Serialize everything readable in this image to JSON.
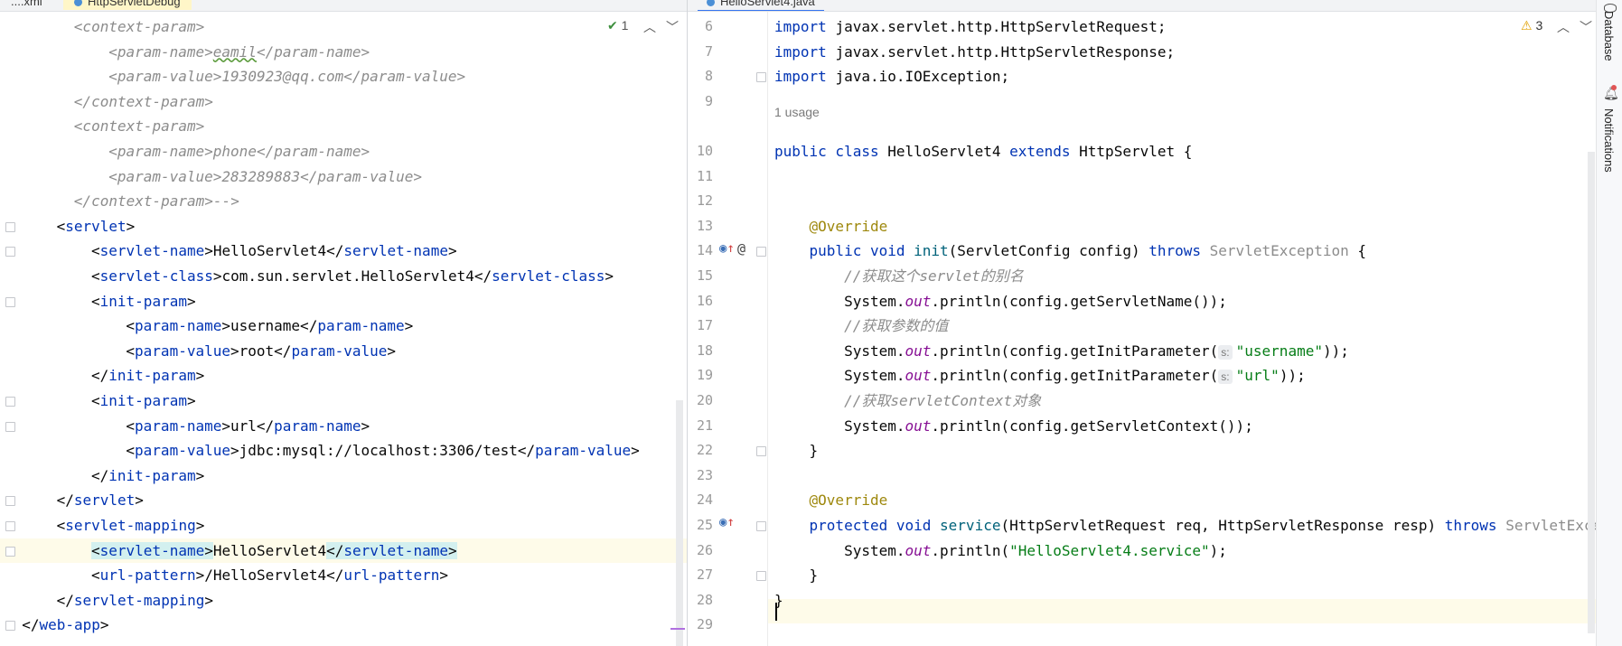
{
  "tabs": [
    {
      "label": "....xml",
      "active": false
    },
    {
      "label": "HttpServletDebug",
      "active": false
    },
    {
      "label": "HelloServlet4.java",
      "active": true
    }
  ],
  "right_tool_window": {
    "database_label": "Database",
    "notifications_label": "Notifications"
  },
  "left_editor": {
    "check_count": "1",
    "lines": [
      {
        "id": "l1",
        "indent": 4,
        "tokens": [
          {
            "t": "<context-param>",
            "c": "com"
          }
        ]
      },
      {
        "id": "l2",
        "indent": 6,
        "tokens": [
          {
            "t": "<param-name>",
            "c": "com"
          },
          {
            "t": "eamil",
            "c": "com under"
          },
          {
            "t": "</param-name>",
            "c": "com"
          }
        ]
      },
      {
        "id": "l3",
        "indent": 6,
        "tokens": [
          {
            "t": "<param-value>1930923@qq.com</param-value>",
            "c": "com"
          }
        ]
      },
      {
        "id": "l4",
        "indent": 4,
        "tokens": [
          {
            "t": "</context-param>",
            "c": "com"
          }
        ]
      },
      {
        "id": "l5",
        "indent": 4,
        "tokens": [
          {
            "t": "<context-param>",
            "c": "com"
          }
        ]
      },
      {
        "id": "l6",
        "indent": 6,
        "tokens": [
          {
            "t": "<param-name>phone</param-name>",
            "c": "com"
          }
        ]
      },
      {
        "id": "l7",
        "indent": 6,
        "tokens": [
          {
            "t": "<param-value>283289883</param-value>",
            "c": "com"
          }
        ]
      },
      {
        "id": "l8",
        "indent": 4,
        "tokens": [
          {
            "t": "</context-param>-->",
            "c": "com"
          }
        ]
      },
      {
        "id": "l9",
        "indent": 3,
        "tokens": [
          {
            "t": "<",
            "c": "txt"
          },
          {
            "t": "servlet",
            "c": "tag"
          },
          {
            "t": ">",
            "c": "txt"
          }
        ]
      },
      {
        "id": "l10",
        "indent": 5,
        "tokens": [
          {
            "t": "<",
            "c": "txt"
          },
          {
            "t": "servlet-name",
            "c": "tag"
          },
          {
            "t": ">HelloServlet4</",
            "c": "txt"
          },
          {
            "t": "servlet-name",
            "c": "tag"
          },
          {
            "t": ">",
            "c": "txt"
          }
        ]
      },
      {
        "id": "l11",
        "indent": 5,
        "tokens": [
          {
            "t": "<",
            "c": "txt"
          },
          {
            "t": "servlet-class",
            "c": "tag"
          },
          {
            "t": ">com.sun.servlet.HelloServlet4</",
            "c": "txt"
          },
          {
            "t": "servlet-class",
            "c": "tag"
          },
          {
            "t": ">",
            "c": "txt"
          }
        ]
      },
      {
        "id": "l12",
        "indent": 5,
        "tokens": [
          {
            "t": "<",
            "c": "txt"
          },
          {
            "t": "init-param",
            "c": "tag"
          },
          {
            "t": ">",
            "c": "txt"
          }
        ]
      },
      {
        "id": "l13",
        "indent": 7,
        "tokens": [
          {
            "t": "<",
            "c": "txt"
          },
          {
            "t": "param-name",
            "c": "tag"
          },
          {
            "t": ">username</",
            "c": "txt"
          },
          {
            "t": "param-name",
            "c": "tag"
          },
          {
            "t": ">",
            "c": "txt"
          }
        ]
      },
      {
        "id": "l14",
        "indent": 7,
        "tokens": [
          {
            "t": "<",
            "c": "txt"
          },
          {
            "t": "param-value",
            "c": "tag"
          },
          {
            "t": ">root</",
            "c": "txt"
          },
          {
            "t": "param-value",
            "c": "tag"
          },
          {
            "t": ">",
            "c": "txt"
          }
        ]
      },
      {
        "id": "l15",
        "indent": 5,
        "tokens": [
          {
            "t": "</",
            "c": "txt"
          },
          {
            "t": "init-param",
            "c": "tag"
          },
          {
            "t": ">",
            "c": "txt"
          }
        ]
      },
      {
        "id": "l16",
        "indent": 5,
        "tokens": [
          {
            "t": "<",
            "c": "txt"
          },
          {
            "t": "init-param",
            "c": "tag"
          },
          {
            "t": ">",
            "c": "txt"
          }
        ]
      },
      {
        "id": "l17",
        "indent": 7,
        "tokens": [
          {
            "t": "<",
            "c": "txt"
          },
          {
            "t": "param-name",
            "c": "tag"
          },
          {
            "t": ">url</",
            "c": "txt"
          },
          {
            "t": "param-name",
            "c": "tag"
          },
          {
            "t": ">",
            "c": "txt"
          }
        ]
      },
      {
        "id": "l18",
        "indent": 7,
        "tokens": [
          {
            "t": "<",
            "c": "txt"
          },
          {
            "t": "param-value",
            "c": "tag"
          },
          {
            "t": ">jdbc:mysql://localhost:3306/test</",
            "c": "txt"
          },
          {
            "t": "param-value",
            "c": "tag"
          },
          {
            "t": ">",
            "c": "txt"
          }
        ]
      },
      {
        "id": "l19",
        "indent": 5,
        "tokens": [
          {
            "t": "</",
            "c": "txt"
          },
          {
            "t": "init-param",
            "c": "tag"
          },
          {
            "t": ">",
            "c": "txt"
          }
        ]
      },
      {
        "id": "l20",
        "indent": 3,
        "tokens": [
          {
            "t": "</",
            "c": "txt"
          },
          {
            "t": "servlet",
            "c": "tag"
          },
          {
            "t": ">",
            "c": "txt"
          }
        ]
      },
      {
        "id": "l21",
        "indent": 3,
        "tokens": [
          {
            "t": "<",
            "c": "txt"
          },
          {
            "t": "servlet-mapping",
            "c": "tag"
          },
          {
            "t": ">",
            "c": "txt"
          }
        ]
      },
      {
        "id": "l22",
        "indent": 5,
        "hl": true,
        "tokens": [
          {
            "t": "<",
            "c": "txt tag-hl"
          },
          {
            "t": "servlet-name",
            "c": "tag tag-hl"
          },
          {
            "t": ">",
            "c": "txt tag-hl"
          },
          {
            "t": "HelloServlet4",
            "c": "txt"
          },
          {
            "t": "</",
            "c": "txt tag-hl"
          },
          {
            "t": "servlet-name",
            "c": "tag tag-hl"
          },
          {
            "t": ">",
            "c": "txt tag-hl"
          }
        ]
      },
      {
        "id": "l23",
        "indent": 5,
        "tokens": [
          {
            "t": "<",
            "c": "txt"
          },
          {
            "t": "url-pattern",
            "c": "tag"
          },
          {
            "t": ">/HelloServlet4</",
            "c": "txt"
          },
          {
            "t": "url-pattern",
            "c": "tag"
          },
          {
            "t": ">",
            "c": "txt"
          }
        ]
      },
      {
        "id": "l24",
        "indent": 3,
        "tokens": [
          {
            "t": "</",
            "c": "txt"
          },
          {
            "t": "servlet-mapping",
            "c": "tag"
          },
          {
            "t": ">",
            "c": "txt"
          }
        ]
      },
      {
        "id": "l25",
        "indent": 1,
        "tokens": [
          {
            "t": "</",
            "c": "txt"
          },
          {
            "t": "web-app",
            "c": "tag"
          },
          {
            "t": ">",
            "c": "txt"
          }
        ]
      }
    ]
  },
  "right_editor": {
    "warning_count": "3",
    "usage_hint": "1 usage",
    "lines": [
      {
        "n": "6",
        "tokens": [
          {
            "t": "import ",
            "c": "kw"
          },
          {
            "t": "javax.servlet.http.HttpServletRequest;",
            "c": "txt"
          }
        ]
      },
      {
        "n": "7",
        "tokens": [
          {
            "t": "import ",
            "c": "kw"
          },
          {
            "t": "javax.servlet.http.HttpServletResponse;",
            "c": "txt"
          }
        ]
      },
      {
        "n": "8",
        "tokens": [
          {
            "t": "import ",
            "c": "kw"
          },
          {
            "t": "java.io.IOException;",
            "c": "txt"
          }
        ]
      },
      {
        "n": "9",
        "tokens": []
      },
      {
        "n": "10",
        "tokens": [
          {
            "t": "public class ",
            "c": "kw"
          },
          {
            "t": "HelloServlet4 ",
            "c": "txt"
          },
          {
            "t": "extends ",
            "c": "kw"
          },
          {
            "t": "HttpServlet {",
            "c": "txt"
          }
        ]
      },
      {
        "n": "11",
        "tokens": []
      },
      {
        "n": "12",
        "tokens": []
      },
      {
        "n": "13",
        "tokens": [
          {
            "t": "    @Override",
            "c": "ann"
          }
        ]
      },
      {
        "n": "14",
        "tokens": [
          {
            "t": "    public void ",
            "c": "kw"
          },
          {
            "t": "init",
            "c": "fn"
          },
          {
            "t": "(ServletConfig config) ",
            "c": "txt"
          },
          {
            "t": "throws ",
            "c": "kw"
          },
          {
            "t": "ServletException ",
            "c": "gray"
          },
          {
            "t": "{",
            "c": "txt"
          }
        ]
      },
      {
        "n": "15",
        "tokens": [
          {
            "t": "        //获取这个servlet的别名",
            "c": "cmt"
          }
        ]
      },
      {
        "n": "16",
        "tokens": [
          {
            "t": "        System.",
            "c": "txt"
          },
          {
            "t": "out",
            "c": "it"
          },
          {
            "t": ".println(config.getServletName());",
            "c": "txt"
          }
        ]
      },
      {
        "n": "17",
        "tokens": [
          {
            "t": "        //获取参数的值",
            "c": "cmt"
          }
        ]
      },
      {
        "n": "18",
        "tokens": [
          {
            "t": "        System.",
            "c": "txt"
          },
          {
            "t": "out",
            "c": "it"
          },
          {
            "t": ".println(config.getInitParameter(",
            "c": "txt"
          },
          {
            "t": "s:",
            "c": "hint"
          },
          {
            "t": "\"username\"",
            "c": "st"
          },
          {
            "t": "));",
            "c": "txt"
          }
        ]
      },
      {
        "n": "19",
        "tokens": [
          {
            "t": "        System.",
            "c": "txt"
          },
          {
            "t": "out",
            "c": "it"
          },
          {
            "t": ".println(config.getInitParameter(",
            "c": "txt"
          },
          {
            "t": "s:",
            "c": "hint"
          },
          {
            "t": "\"url\"",
            "c": "st"
          },
          {
            "t": "));",
            "c": "txt"
          }
        ]
      },
      {
        "n": "20",
        "tokens": [
          {
            "t": "        //获取servletContext对象",
            "c": "cmt"
          }
        ]
      },
      {
        "n": "21",
        "tokens": [
          {
            "t": "        System.",
            "c": "txt"
          },
          {
            "t": "out",
            "c": "it"
          },
          {
            "t": ".println(config.getServletContext());",
            "c": "txt"
          }
        ]
      },
      {
        "n": "22",
        "tokens": [
          {
            "t": "    }",
            "c": "txt"
          }
        ]
      },
      {
        "n": "23",
        "tokens": []
      },
      {
        "n": "24",
        "tokens": [
          {
            "t": "    @Override",
            "c": "ann"
          }
        ]
      },
      {
        "n": "25",
        "tokens": [
          {
            "t": "    protected void ",
            "c": "kw"
          },
          {
            "t": "service",
            "c": "fn"
          },
          {
            "t": "(HttpServletRequest req, HttpServletResponse resp) ",
            "c": "txt"
          },
          {
            "t": "throws ",
            "c": "kw"
          },
          {
            "t": "ServletException",
            "c": "gray"
          }
        ]
      },
      {
        "n": "26",
        "tokens": [
          {
            "t": "        System.",
            "c": "txt"
          },
          {
            "t": "out",
            "c": "it"
          },
          {
            "t": ".println(",
            "c": "txt"
          },
          {
            "t": "\"HelloServlet4.service\"",
            "c": "st"
          },
          {
            "t": ");",
            "c": "txt"
          }
        ]
      },
      {
        "n": "27",
        "tokens": [
          {
            "t": "    }",
            "c": "txt"
          }
        ]
      },
      {
        "n": "28",
        "tokens": [
          {
            "t": "}",
            "c": "txt"
          }
        ]
      },
      {
        "n": "29",
        "tokens": []
      }
    ]
  }
}
